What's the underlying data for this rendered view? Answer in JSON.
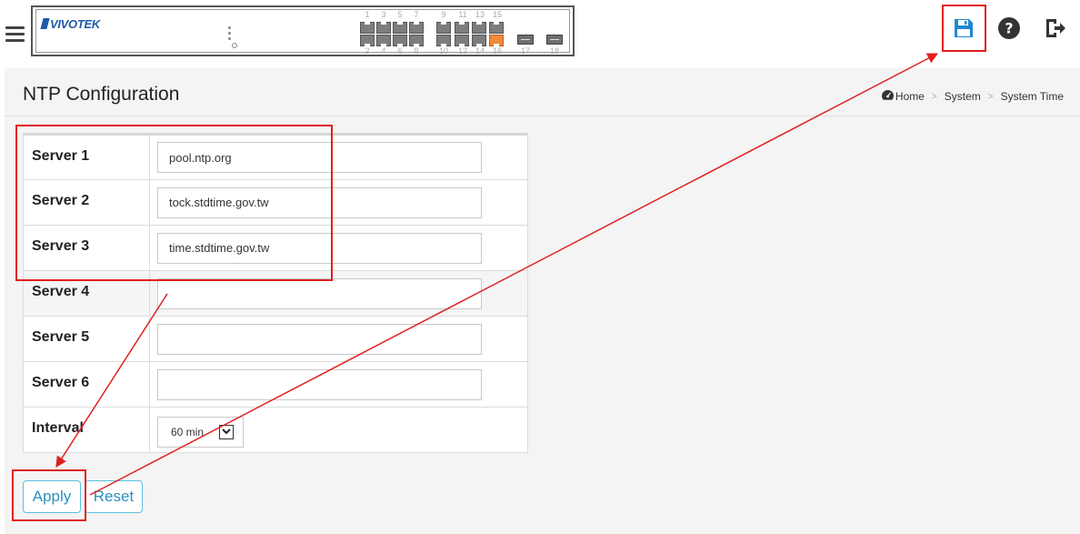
{
  "header": {
    "brand": "VIVOTEK",
    "ports_top": [
      "1",
      "3",
      "5",
      "7",
      "9",
      "11",
      "13",
      "15"
    ],
    "ports_bottom": [
      "2",
      "4",
      "6",
      "8",
      "10",
      "12",
      "14",
      "16"
    ],
    "sfp_ports": [
      "17",
      "18"
    ],
    "icons": {
      "save": "save-icon",
      "help": "help-icon",
      "logout": "logout-icon"
    },
    "accent_color": "#1e88d2",
    "active_port_color": "#f08a3c"
  },
  "page": {
    "title": "NTP Configuration",
    "breadcrumb": {
      "home": "Home",
      "section": "System",
      "current": "System Time",
      "home_icon": "dashboard-icon"
    }
  },
  "form": {
    "servers": [
      {
        "label": "Server 1",
        "value": "pool.ntp.org"
      },
      {
        "label": "Server 2",
        "value": "tock.stdtime.gov.tw"
      },
      {
        "label": "Server 3",
        "value": "time.stdtime.gov.tw"
      },
      {
        "label": "Server 4",
        "value": ""
      },
      {
        "label": "Server 5",
        "value": ""
      },
      {
        "label": "Server 6",
        "value": ""
      }
    ],
    "interval": {
      "label": "Interval",
      "value": "60 min"
    }
  },
  "buttons": {
    "apply": "Apply",
    "reset": "Reset"
  },
  "annotation_color": "#e02020"
}
